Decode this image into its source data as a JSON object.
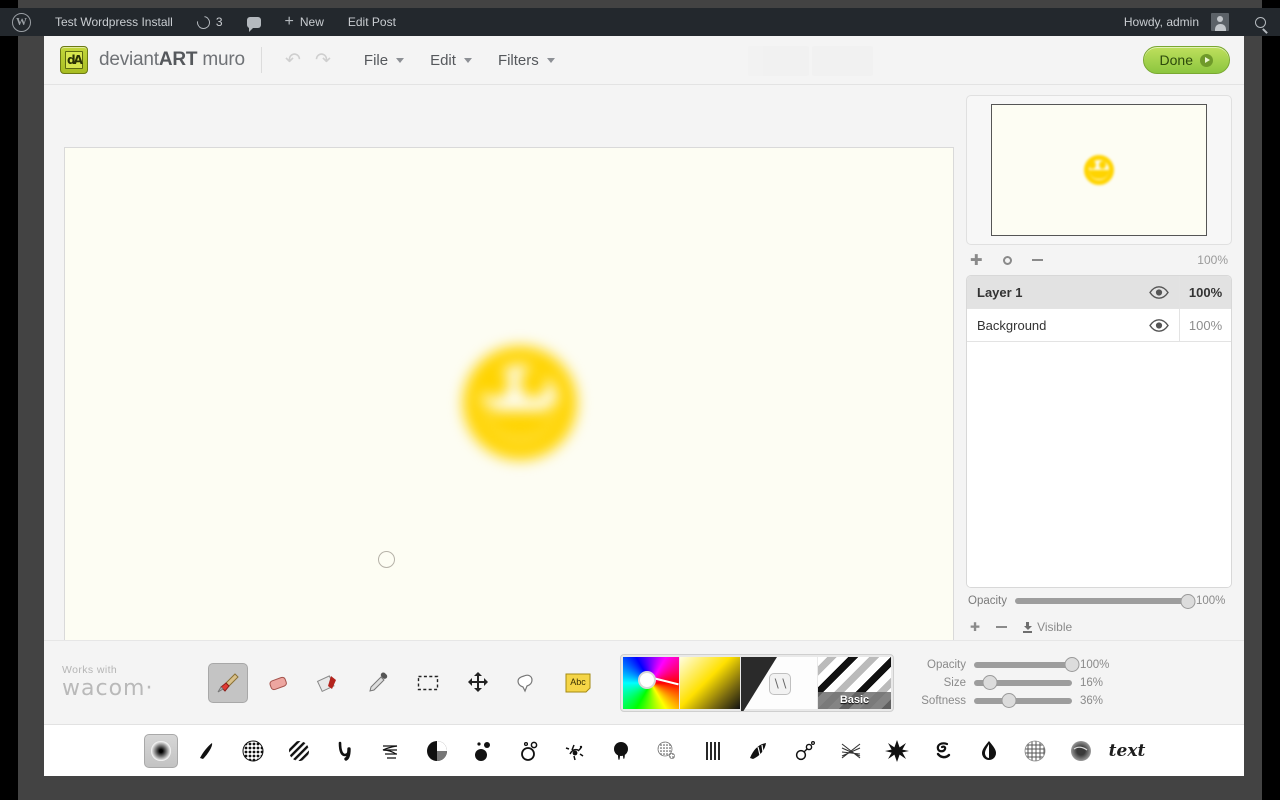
{
  "adminbar": {
    "logo_icon": "wordpress-logo-icon",
    "site_title": "Test Wordpress Install",
    "updates_icon": "refresh-icon",
    "updates_count": "3",
    "comments_icon": "comment-bubble-icon",
    "new_icon": "plus-icon",
    "new_label": "New",
    "edit_post_label": "Edit Post",
    "howdy": "Howdy, admin",
    "avatar_icon": "avatar-icon",
    "search_icon": "search-icon"
  },
  "header": {
    "logo_mark_icon": "deviantart-logo-icon",
    "logo_glyph": "dA",
    "brand_prefix": "deviant",
    "brand_bold": "ART",
    "brand_suffix": " muro",
    "undo_icon": "undo-icon",
    "undo_glyph": "↶",
    "redo_icon": "redo-icon",
    "redo_glyph": "↷",
    "menus": [
      {
        "label": "File"
      },
      {
        "label": "Edit"
      },
      {
        "label": "Filters"
      }
    ],
    "done_label": "Done",
    "done_icon": "play-circle-icon",
    "done_color": "#8cc63f"
  },
  "canvas": {
    "background_color": "#fdfdf3",
    "drawing_name": "smiley-face-drawing",
    "drawing_color": "#ffd400",
    "cursor_name": "brush-cursor"
  },
  "navigator": {
    "thumbnail_name": "canvas-thumbnail",
    "zoom_in_glyph": "✚",
    "zoom_reset_icon": "zoom-reset-icon",
    "zoom_out_icon": "zoom-out-icon",
    "zoom_level": "100%"
  },
  "layers": {
    "rows": [
      {
        "name": "Layer 1",
        "opacity": "100%",
        "selected": true,
        "visible_icon": "eye-icon"
      },
      {
        "name": "Background",
        "opacity": "100%",
        "selected": false,
        "visible_icon": "eye-icon"
      }
    ],
    "opacity_label": "Opacity",
    "opacity_value": "100%",
    "opacity_percent": 100,
    "add_layer_glyph": "✚",
    "remove_layer_icon": "minus-icon",
    "visible_label": "Visible",
    "visible_icon": "download-icon"
  },
  "toolbar": {
    "wacom_tagline": "Works with",
    "wacom_brand": "wacom·",
    "tools": [
      {
        "name": "brush-tool",
        "active": true
      },
      {
        "name": "eraser-tool",
        "active": false
      },
      {
        "name": "blender-tool",
        "active": false
      },
      {
        "name": "eyedropper-tool",
        "active": false
      },
      {
        "name": "selection-tool",
        "active": false
      },
      {
        "name": "move-tool",
        "active": false
      },
      {
        "name": "smudge-tool",
        "active": false
      },
      {
        "name": "text-tool",
        "active": false,
        "glyph": "Abc"
      }
    ],
    "swatches": {
      "wheel_name": "color-wheel",
      "value_name": "value-gradient",
      "swatch_name": "color-swatch",
      "texture_name": "texture-preview",
      "texture_label": "Basic"
    },
    "sliders": [
      {
        "label": "Opacity",
        "value": "100%",
        "percent": 100
      },
      {
        "label": "Size",
        "value": "16%",
        "percent": 16
      },
      {
        "label": "Softness",
        "value": "36%",
        "percent": 36
      }
    ]
  },
  "brush_presets": [
    {
      "name": "soft-round-brush",
      "active": true
    },
    {
      "name": "hard-tapered-brush",
      "active": false
    },
    {
      "name": "dotted-grid-brush",
      "active": false
    },
    {
      "name": "hatched-circle-brush",
      "active": false
    },
    {
      "name": "ribbon-stroke-brush",
      "active": false
    },
    {
      "name": "scribble-brush",
      "active": false
    },
    {
      "name": "half-tone-brush",
      "active": false
    },
    {
      "name": "dot-cluster-brush",
      "active": false
    },
    {
      "name": "outline-bubble-brush",
      "active": false
    },
    {
      "name": "splatter-brush",
      "active": false
    },
    {
      "name": "drip-blob-brush",
      "active": false
    },
    {
      "name": "speckle-brush",
      "active": false
    },
    {
      "name": "rake-lines-brush",
      "active": false
    },
    {
      "name": "fan-brush",
      "active": false
    },
    {
      "name": "chain-brush",
      "active": false
    },
    {
      "name": "crosshatch-brush",
      "active": false
    },
    {
      "name": "starburst-brush",
      "active": false
    },
    {
      "name": "swirl-brush",
      "active": false
    },
    {
      "name": "ink-drop-brush",
      "active": false
    },
    {
      "name": "sponge-brush",
      "active": false
    },
    {
      "name": "grain-ball-brush",
      "active": false
    },
    {
      "name": "text-brush",
      "active": false,
      "glyph": "text"
    }
  ]
}
